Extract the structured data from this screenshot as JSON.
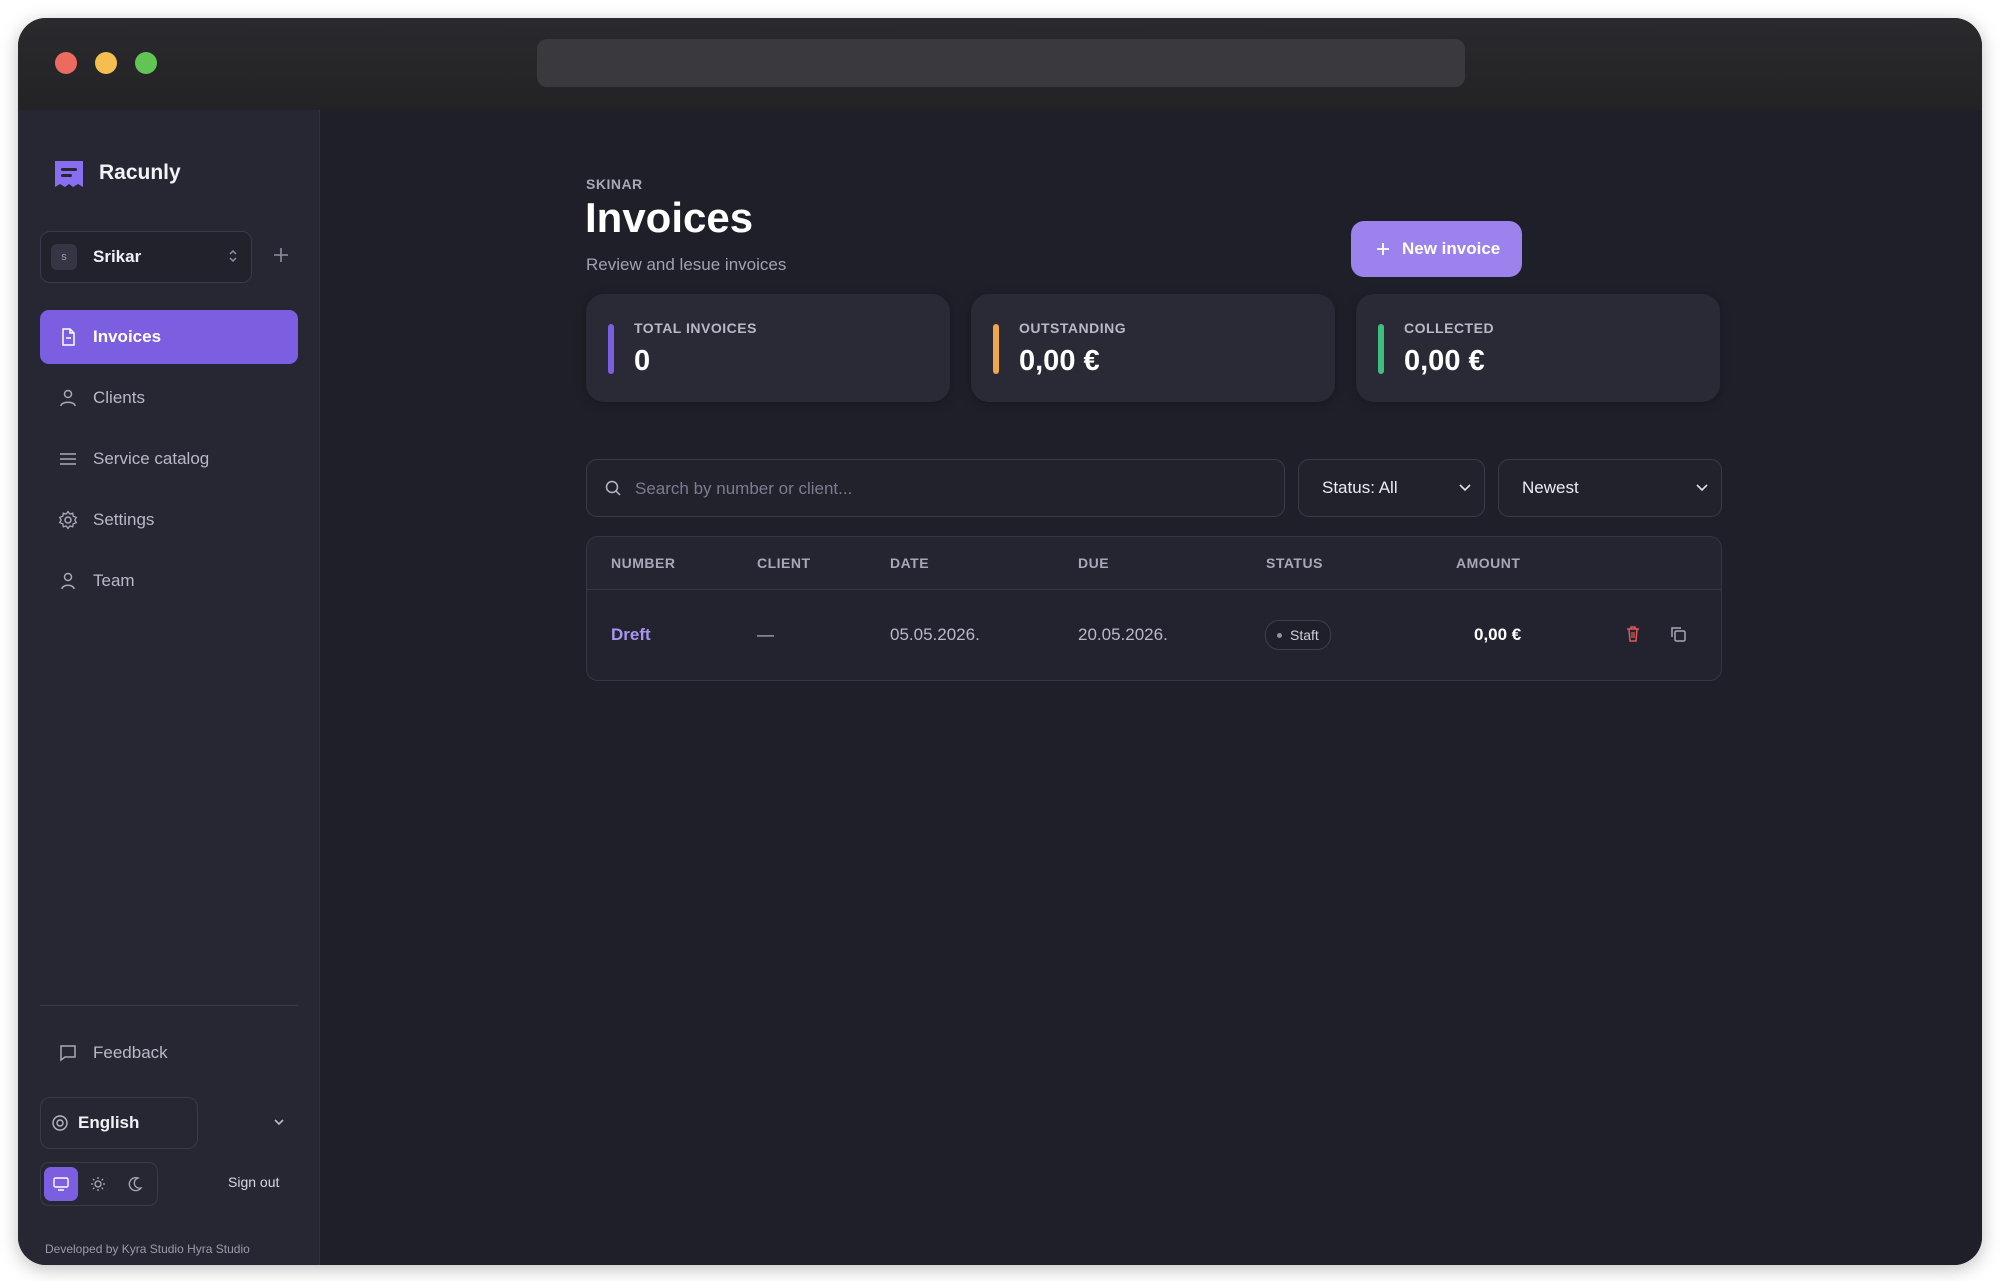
{
  "app": {
    "name": "Racunly"
  },
  "org": {
    "avatar": "s",
    "name": "Srikar"
  },
  "nav": [
    {
      "label": "Invoices",
      "icon": "document-icon",
      "active": true
    },
    {
      "label": "Clients",
      "icon": "user-icon"
    },
    {
      "label": "Service catalog",
      "icon": "list-icon"
    },
    {
      "label": "Settings",
      "icon": "gear-icon"
    },
    {
      "label": "Team",
      "icon": "user-icon"
    }
  ],
  "sidebar_footer": {
    "feedback": "Feedback",
    "language": "English",
    "sign_out": "Sign out",
    "credit": "Developed by Kyra Studio Hyra Studio"
  },
  "header": {
    "eyebrow": "SKINAR",
    "title": "Invoices",
    "subtitle": "Review and lesue invoices",
    "new_button": "New invoice"
  },
  "stats": [
    {
      "label": "TOTAL INVOICES",
      "value": "0",
      "color": "#7b5fe0"
    },
    {
      "label": "OUTSTANDING",
      "value": "0,00 €",
      "color": "#f0a64a"
    },
    {
      "label": "COLLECTED",
      "value": "0,00 €",
      "color": "#3fbf7f"
    }
  ],
  "filters": {
    "search_placeholder": "Search by number or client...",
    "status": "Status: All",
    "sort": "Newest"
  },
  "table": {
    "columns": [
      "NUMBER",
      "CLIENT",
      "DATE",
      "DUE",
      "STATUS",
      "AMOUNT"
    ],
    "rows": [
      {
        "number": "Dreft",
        "client": "—",
        "date": "05.05.2026.",
        "due": "20.05.2026.",
        "status": "Staft",
        "amount": "0,00 €"
      }
    ]
  },
  "colors": {
    "accent": "#7b5fe0",
    "accent_light": "#9b82ec",
    "danger": "#e05a5a"
  }
}
